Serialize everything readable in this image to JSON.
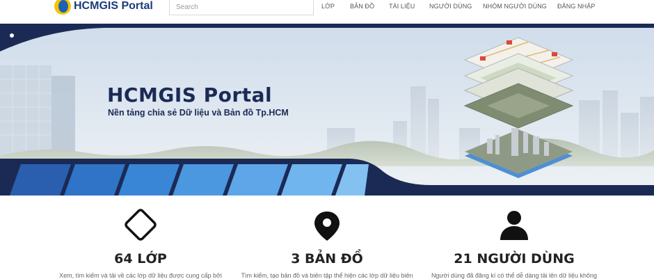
{
  "header": {
    "logo_text": "HCMGIS Portal",
    "search_placeholder": "Search",
    "nav": [
      "LỚP",
      "BẢN ĐỒ",
      "TÀI LIỆU",
      "NGƯỜI DÙNG",
      "NHÓM NGƯỜI DÙNG",
      "ĐĂNG NHẬP"
    ]
  },
  "banner": {
    "title": "HCMGIS Portal",
    "subtitle": "Nền tảng chia sẻ Dữ liệu và Bản đồ Tp.HCM"
  },
  "stats": [
    {
      "icon": "diamond-icon",
      "value": "64 LỚP",
      "desc": "Xem, tìm kiếm và tải về các lớp dữ liệu được cung cấp bởi"
    },
    {
      "icon": "map-pin-icon",
      "value": "3 BẢN ĐỒ",
      "desc": "Tìm kiếm, tạo bản đồ và biên tập thể hiện các lớp dữ liệu biên"
    },
    {
      "icon": "user-icon",
      "value": "21 NGƯỜI DÙNG",
      "desc": "Người dùng đã đăng kí có thể dễ dàng tải lên dữ liệu không"
    }
  ],
  "colors": {
    "brand_navy": "#1b2a55",
    "accent_blue": "#2f7fd8",
    "logo_yellow": "#f2c400"
  }
}
